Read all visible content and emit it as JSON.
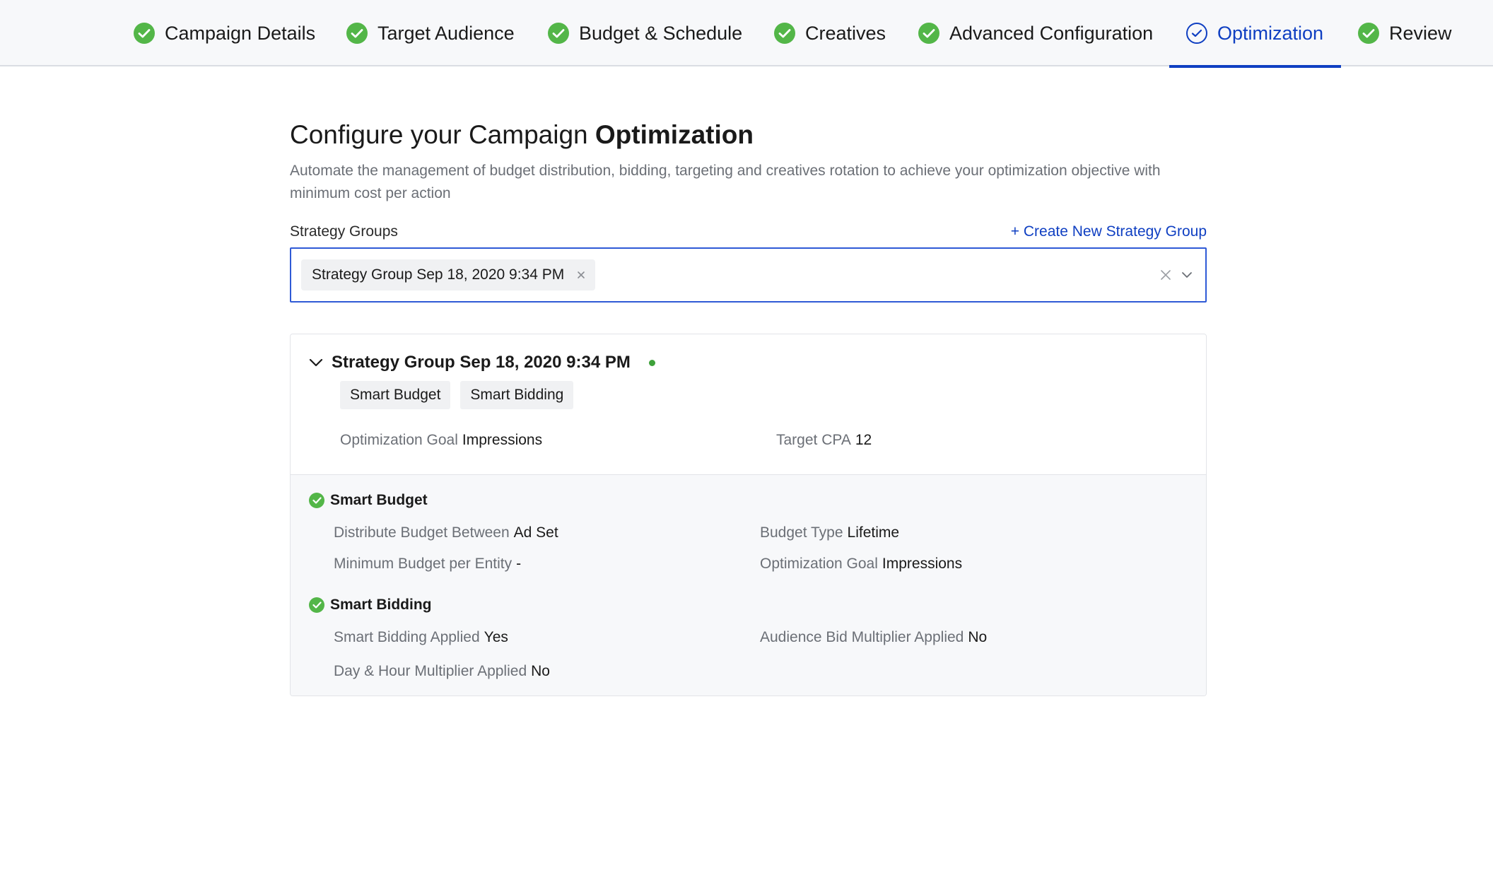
{
  "steps": [
    {
      "label": "Campaign Details",
      "state": "done"
    },
    {
      "label": "Target Audience",
      "state": "done"
    },
    {
      "label": "Budget & Schedule",
      "state": "done"
    },
    {
      "label": "Creatives",
      "state": "done"
    },
    {
      "label": "Advanced Configuration",
      "state": "done"
    },
    {
      "label": "Optimization",
      "state": "active"
    },
    {
      "label": "Review",
      "state": "done"
    }
  ],
  "header": {
    "title_prefix": "Configure your Campaign",
    "title_bold": "Optimization",
    "description": "Automate the management of budget distribution, bidding, targeting and creatives rotation to achieve your optimization objective with minimum cost per action"
  },
  "strategy_groups": {
    "label": "Strategy Groups",
    "create_link": "+ Create New Strategy Group",
    "selected_chip": "Strategy Group Sep 18, 2020 9:34 PM"
  },
  "card": {
    "title": "Strategy Group Sep 18, 2020 9:34 PM",
    "tags": [
      "Smart Budget",
      "Smart Bidding"
    ],
    "optimization_goal_label": "Optimization Goal",
    "optimization_goal_value": "Impressions",
    "target_cpa_label": "Target CPA",
    "target_cpa_value": "12",
    "smart_budget": {
      "title": "Smart Budget",
      "distribute_label": "Distribute Budget Between",
      "distribute_value": "Ad Set",
      "budget_type_label": "Budget Type",
      "budget_type_value": "Lifetime",
      "min_budget_label": "Minimum Budget per Entity",
      "min_budget_value": "-",
      "opt_goal_label": "Optimization Goal",
      "opt_goal_value": "Impressions"
    },
    "smart_bidding": {
      "title": "Smart Bidding",
      "applied_label": "Smart Bidding Applied",
      "applied_value": "Yes",
      "audience_label": "Audience Bid Multiplier Applied",
      "audience_value": "No",
      "dayhour_label": "Day & Hour Multiplier Applied",
      "dayhour_value": "No"
    }
  },
  "colors": {
    "accent": "#0f3fc2",
    "success": "#53b648",
    "status_dot": "#3ea13a"
  }
}
